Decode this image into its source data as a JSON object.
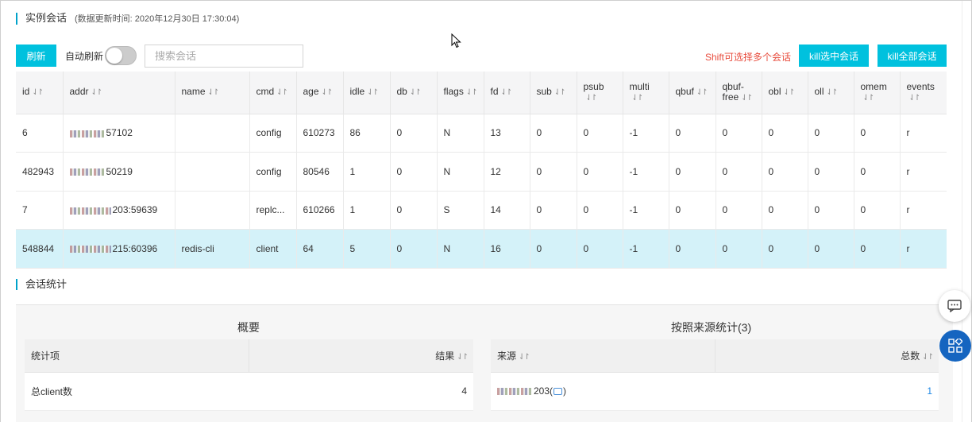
{
  "section_sessions": {
    "title": "实例会话",
    "updated": "(数据更新时间: 2020年12月30日 17:30:04)"
  },
  "toolbar": {
    "refresh_label": "刷新",
    "auto_refresh_label": "自动刷新",
    "auto_refresh_on": false,
    "search_placeholder": "搜索会话",
    "hint": "Shift可选择多个会话",
    "kill_selected_label": "kill选中会话",
    "kill_all_label": "kill全部会话"
  },
  "sort_icon": "⇃↾",
  "columns": [
    "id",
    "addr",
    "name",
    "cmd",
    "age",
    "idle",
    "db",
    "flags",
    "fd",
    "sub",
    "psub",
    "multi",
    "qbuf",
    "qbuf-free",
    "obl",
    "oll",
    "omem",
    "events"
  ],
  "rows": [
    {
      "id": "6",
      "addr": "57102",
      "name": "",
      "cmd": "config",
      "age": "610273",
      "idle": "86",
      "db": "0",
      "flags": "N",
      "fd": "13",
      "sub": "0",
      "psub": "0",
      "multi": "-1",
      "qbuf": "0",
      "qbuf_free": "0",
      "obl": "0",
      "oll": "0",
      "omem": "0",
      "events": "r",
      "selected": false
    },
    {
      "id": "482943",
      "addr": "50219",
      "name": "",
      "cmd": "config",
      "age": "80546",
      "idle": "1",
      "db": "0",
      "flags": "N",
      "fd": "12",
      "sub": "0",
      "psub": "0",
      "multi": "-1",
      "qbuf": "0",
      "qbuf_free": "0",
      "obl": "0",
      "oll": "0",
      "omem": "0",
      "events": "r",
      "selected": false
    },
    {
      "id": "7",
      "addr": "203:59639",
      "name": "",
      "cmd": "replc...",
      "age": "610266",
      "idle": "1",
      "db": "0",
      "flags": "S",
      "fd": "14",
      "sub": "0",
      "psub": "0",
      "multi": "-1",
      "qbuf": "0",
      "qbuf_free": "0",
      "obl": "0",
      "oll": "0",
      "omem": "0",
      "events": "r",
      "selected": false
    },
    {
      "id": "548844",
      "addr": "215:60396",
      "name": "redis-cli",
      "cmd": "client",
      "age": "64",
      "idle": "5",
      "db": "0",
      "flags": "N",
      "fd": "16",
      "sub": "0",
      "psub": "0",
      "multi": "-1",
      "qbuf": "0",
      "qbuf_free": "0",
      "obl": "0",
      "oll": "0",
      "omem": "0",
      "events": "r",
      "selected": true
    }
  ],
  "section_stats": {
    "title": "会话统计"
  },
  "overview": {
    "title": "概要",
    "col_item": "统计项",
    "col_result": "结果",
    "rows": [
      {
        "item": "总client数",
        "result": "4"
      }
    ]
  },
  "by_source": {
    "title": "按照来源统计(3)",
    "col_source": "来源",
    "col_total": "总数",
    "rows": [
      {
        "source_suffix": "203(",
        "source_close": ")",
        "total": "1"
      }
    ]
  },
  "icons": {
    "chat": "chat-bubble-icon",
    "apps": "apps-grid-icon",
    "cursor": "mouse-pointer-icon",
    "share": "share-icon"
  },
  "colors": {
    "primary": "#00c1de",
    "hint": "#e84c3d",
    "selected_row": "#d4f2f9",
    "float_apps": "#1565c0"
  }
}
